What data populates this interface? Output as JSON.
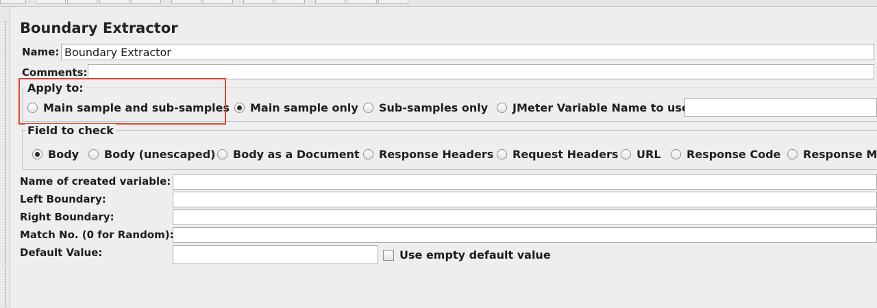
{
  "panel": {
    "title": "Boundary Extractor"
  },
  "name_field": {
    "label": "Name:",
    "value": "Boundary Extractor"
  },
  "comments_field": {
    "label": "Comments:",
    "value": ""
  },
  "apply_to": {
    "legend": "Apply to:",
    "options": [
      {
        "label": "Main sample and sub-samples",
        "selected": false
      },
      {
        "label": "Main sample only",
        "selected": true
      },
      {
        "label": "Sub-samples only",
        "selected": false
      },
      {
        "label": "JMeter Variable Name to use",
        "selected": false
      }
    ],
    "variable_value": ""
  },
  "field_to_check": {
    "legend": "Field to check",
    "options": [
      {
        "label": "Body",
        "selected": true
      },
      {
        "label": "Body (unescaped)",
        "selected": false
      },
      {
        "label": "Body as a Document",
        "selected": false
      },
      {
        "label": "Response Headers",
        "selected": false
      },
      {
        "label": "Request Headers",
        "selected": false
      },
      {
        "label": "URL",
        "selected": false
      },
      {
        "label": "Response Code",
        "selected": false
      },
      {
        "label": "Response Message",
        "selected": false
      }
    ]
  },
  "form": {
    "created_variable_label": "Name of created variable:",
    "left_boundary_label": "Left Boundary:",
    "right_boundary_label": "Right Boundary:",
    "match_no_label": "Match No. (0 for Random):",
    "default_value_label": "Default Value:",
    "use_empty_default_label": "Use empty default value",
    "use_empty_default_checked": false
  }
}
